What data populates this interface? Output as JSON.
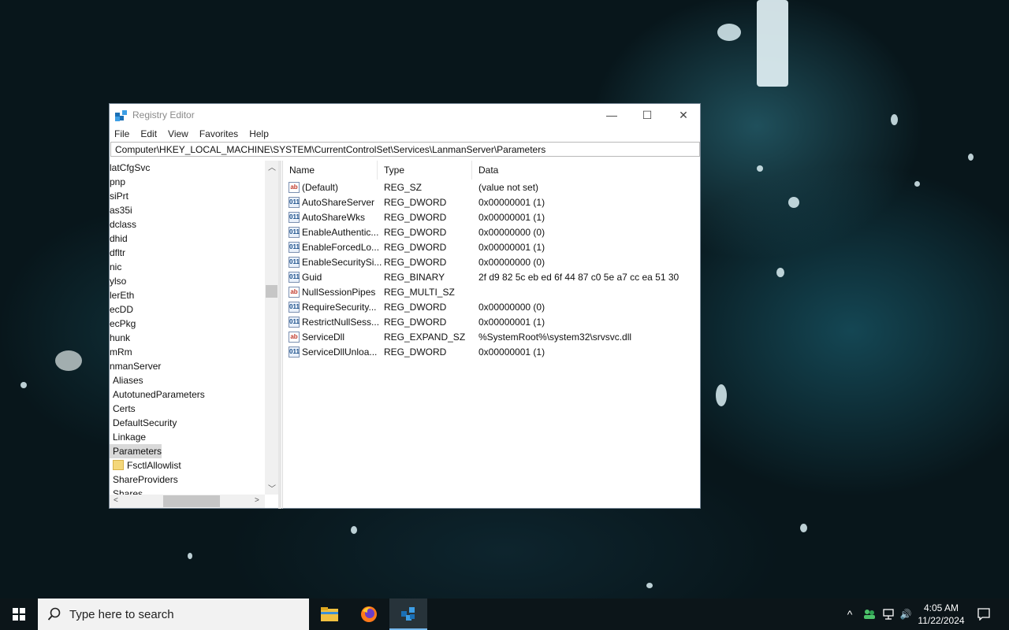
{
  "window": {
    "title": "Registry Editor",
    "minimize_glyph": "—",
    "maximize_glyph": "☐",
    "close_glyph": "✕"
  },
  "menu": [
    "File",
    "Edit",
    "View",
    "Favorites",
    "Help"
  ],
  "address": "Computer\\HKEY_LOCAL_MACHINE\\SYSTEM\\CurrentControlSet\\Services\\LanmanServer\\Parameters",
  "tree": [
    {
      "label": "latCfgSvc"
    },
    {
      "label": "pnp"
    },
    {
      "label": "siPrt"
    },
    {
      "label": "as35i"
    },
    {
      "label": "dclass"
    },
    {
      "label": "dhid"
    },
    {
      "label": "dfltr"
    },
    {
      "label": "nic"
    },
    {
      "label": "ylso"
    },
    {
      "label": "lerEth"
    },
    {
      "label": "ecDD"
    },
    {
      "label": "ecPkg"
    },
    {
      "label": "hunk"
    },
    {
      "label": "mRm"
    },
    {
      "label": "nmanServer"
    },
    {
      "label": "Aliases"
    },
    {
      "label": "AutotunedParameters"
    },
    {
      "label": "Certs"
    },
    {
      "label": "DefaultSecurity"
    },
    {
      "label": "Linkage"
    },
    {
      "label": "Parameters",
      "selected": true
    },
    {
      "label": "FsctlAllowlist",
      "folder": true
    },
    {
      "label": "ShareProviders"
    },
    {
      "label": "Shares"
    }
  ],
  "columns": {
    "name": "Name",
    "type": "Type",
    "data": "Data"
  },
  "values": [
    {
      "icon": "string",
      "name": "(Default)",
      "type": "REG_SZ",
      "data": "(value not set)"
    },
    {
      "icon": "binary",
      "name": "AutoShareServer",
      "type": "REG_DWORD",
      "data": "0x00000001 (1)"
    },
    {
      "icon": "binary",
      "name": "AutoShareWks",
      "type": "REG_DWORD",
      "data": "0x00000001 (1)"
    },
    {
      "icon": "binary",
      "name": "EnableAuthentic...",
      "type": "REG_DWORD",
      "data": "0x00000000 (0)"
    },
    {
      "icon": "binary",
      "name": "EnableForcedLo...",
      "type": "REG_DWORD",
      "data": "0x00000001 (1)"
    },
    {
      "icon": "binary",
      "name": "EnableSecuritySi...",
      "type": "REG_DWORD",
      "data": "0x00000000 (0)"
    },
    {
      "icon": "binary",
      "name": "Guid",
      "type": "REG_BINARY",
      "data": "2f d9 82 5c eb ed 6f 44 87 c0 5e a7 cc ea 51 30"
    },
    {
      "icon": "string",
      "name": "NullSessionPipes",
      "type": "REG_MULTI_SZ",
      "data": ""
    },
    {
      "icon": "binary",
      "name": "RequireSecurity...",
      "type": "REG_DWORD",
      "data": "0x00000000 (0)"
    },
    {
      "icon": "binary",
      "name": "RestrictNullSess...",
      "type": "REG_DWORD",
      "data": "0x00000001 (1)"
    },
    {
      "icon": "string",
      "name": "ServiceDll",
      "type": "REG_EXPAND_SZ",
      "data": "%SystemRoot%\\system32\\srvsvc.dll"
    },
    {
      "icon": "binary",
      "name": "ServiceDllUnloa...",
      "type": "REG_DWORD",
      "data": "0x00000001 (1)"
    }
  ],
  "icon_labels": {
    "string": "ab",
    "binary": "011"
  },
  "taskbar": {
    "search_placeholder": "Type here to search",
    "apps": [
      "file-explorer",
      "firefox",
      "registry-editor"
    ],
    "time": "4:05 AM",
    "date": "11/22/2024",
    "tray_glyphs": {
      "chevron": "^",
      "volume": "🔊",
      "notification": "🗨"
    }
  },
  "colors": {
    "accent": "#76b9ed",
    "taskbar": "#0c1519",
    "selection": "#d9d9d9"
  }
}
